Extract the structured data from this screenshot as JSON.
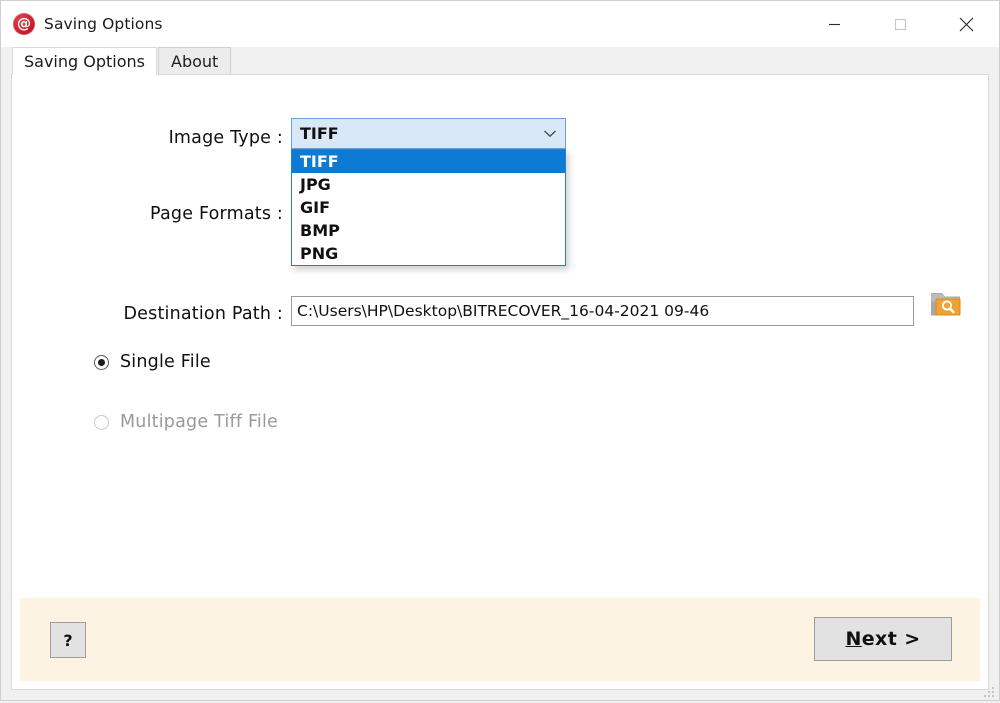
{
  "window": {
    "title": "Saving Options",
    "app_icon": "at-sign-icon",
    "controls": {
      "minimize": "minimize-icon",
      "maximize": "maximize-icon",
      "close": "close-icon"
    }
  },
  "tabs": [
    {
      "label": "Saving Options",
      "active": true
    },
    {
      "label": "About",
      "active": false
    }
  ],
  "form": {
    "image_type": {
      "label": "Image Type  :",
      "value": "TIFF",
      "expanded": true,
      "options": [
        "TIFF",
        "JPG",
        "GIF",
        "BMP",
        "PNG"
      ],
      "selected_index": 0
    },
    "page_formats": {
      "label": "Page Formats  :"
    },
    "destination_path": {
      "label": "Destination Path :",
      "value": "C:\\Users\\HP\\Desktop\\BITRECOVER_16-04-2021 09-46",
      "placeholder": "Destination folder path",
      "browse_icon": "folder-search-icon"
    },
    "file_mode": [
      {
        "label": "Single File",
        "checked": true,
        "disabled": false
      },
      {
        "label": "Multipage Tiff File",
        "checked": false,
        "disabled": true
      }
    ]
  },
  "footer": {
    "help_label": "?",
    "next_label_accel": "N",
    "next_label_rest": "ext >"
  },
  "colors": {
    "accent_blue": "#0d7bd4",
    "combo_fill": "#d6e5f5",
    "footer_bg": "#fdf3e3",
    "app_icon_red": "#c8202e",
    "folder_orange": "#f0a232"
  }
}
